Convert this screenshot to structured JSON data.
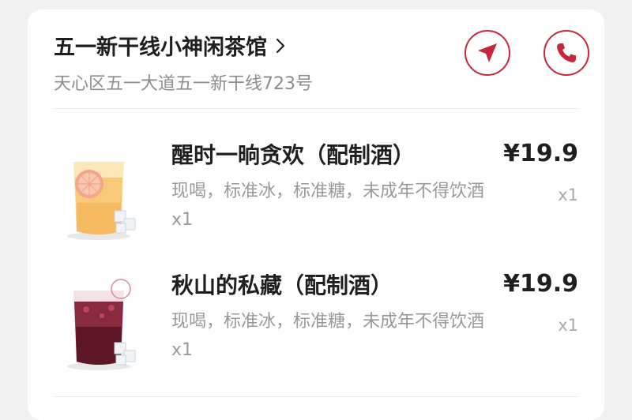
{
  "shop": {
    "name": "五一新干线小神闲茶馆",
    "address": "天心区五一大道五一新干线723号"
  },
  "actions": {
    "navigate_icon": "navigation-arrow-icon",
    "call_icon": "phone-icon"
  },
  "items": [
    {
      "name": "醒时一晌贪欢（配制酒）",
      "description": "现喝，标准冰，标准糖，未成年不得饮酒x1",
      "price": "¥19.9",
      "quantity": "x1"
    },
    {
      "name": "秋山的私藏（配制酒）",
      "description": "现喝，标准冰，标准糖，未成年不得饮酒x1",
      "price": "¥19.9",
      "quantity": "x1"
    }
  ],
  "colors": {
    "accent": "#c3283d",
    "background": "#f2f2f2",
    "card": "#ffffff"
  }
}
